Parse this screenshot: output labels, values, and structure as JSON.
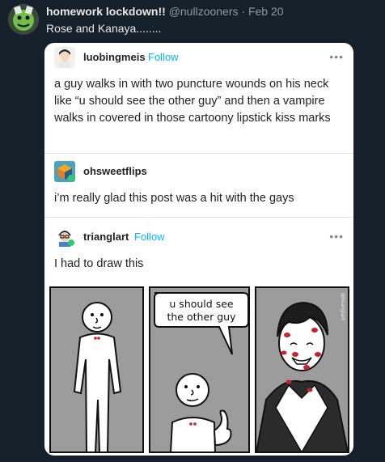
{
  "tweet": {
    "display_name": "homework lockdown!!",
    "handle": "@nullzooners",
    "separator": "·",
    "date": "Feb 20",
    "text": "Rose and Kanaya........"
  },
  "posts": [
    {
      "username": "luobingmeis",
      "follow_label": "Follow",
      "more_label": "•••",
      "body": "a guy walks in with two puncture wounds on his neck like “u should see the other guy” and then a vampire walks in covered in those cartoony lipstick kiss marks"
    },
    {
      "username": "ohsweetflips",
      "body": "i’m really glad this post was a hit with the gays"
    },
    {
      "username": "trianglart",
      "follow_label": "Follow",
      "more_label": "•••",
      "body": "I had to draw this",
      "comic": {
        "speech_line1": "u should see",
        "speech_line2": "the other guy",
        "watermark": "@trianglart"
      }
    }
  ],
  "colors": {
    "background": "#15202b",
    "follow_link": "#00b8ff",
    "panel_gray": "#9c9c9c",
    "lipstick": "#c8232c"
  }
}
